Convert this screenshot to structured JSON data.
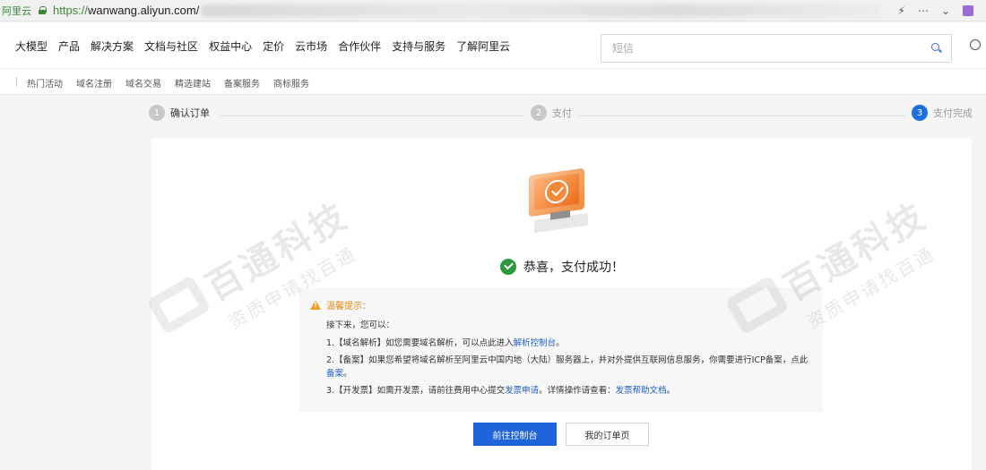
{
  "browser": {
    "site_name": "阿里云",
    "url_host": "https://",
    "url_domain": "wanwang.aliyun.com/"
  },
  "nav": {
    "items": [
      "大模型",
      "产品",
      "解决方案",
      "文档与社区",
      "权益中心",
      "定价",
      "云市场",
      "合作伙伴",
      "支持与服务",
      "了解阿里云"
    ],
    "search_placeholder": "短信"
  },
  "subnav": {
    "items": [
      "热门活动",
      "域名注册",
      "域名交易",
      "精选建站",
      "备案服务",
      "商标服务"
    ]
  },
  "steps": [
    {
      "num": "1",
      "label": "确认订单"
    },
    {
      "num": "2",
      "label": "支付"
    },
    {
      "num": "3",
      "label": "支付完成"
    }
  ],
  "result": {
    "title": "恭喜，支付成功！"
  },
  "tips": {
    "title": "温馨提示：",
    "intro": "接下来，您可以：",
    "line1_text": "1.【域名解析】如您需要域名解析，可以点此进入",
    "line1_link": "解析控制台",
    "line1_end": "。",
    "line2_text": "2.【备案】如果您希望将域名解析至阿里云中国内地（大陆）服务器上，并对外提供互联网信息服务，你需要进行ICP备案，点此",
    "line2_link": "备案",
    "line2_end": "。",
    "line3_text": "3.【开发票】如需开发票，请前往费用中心提交",
    "line3_link1": "发票申请",
    "line3_mid": "。详情操作请查看：",
    "line3_link2": "发票帮助文档",
    "line3_end": "。"
  },
  "buttons": {
    "primary": "前往控制台",
    "secondary": "我的订单页"
  },
  "watermark": {
    "main": "百通科技",
    "sub": "资质申请找百通"
  }
}
